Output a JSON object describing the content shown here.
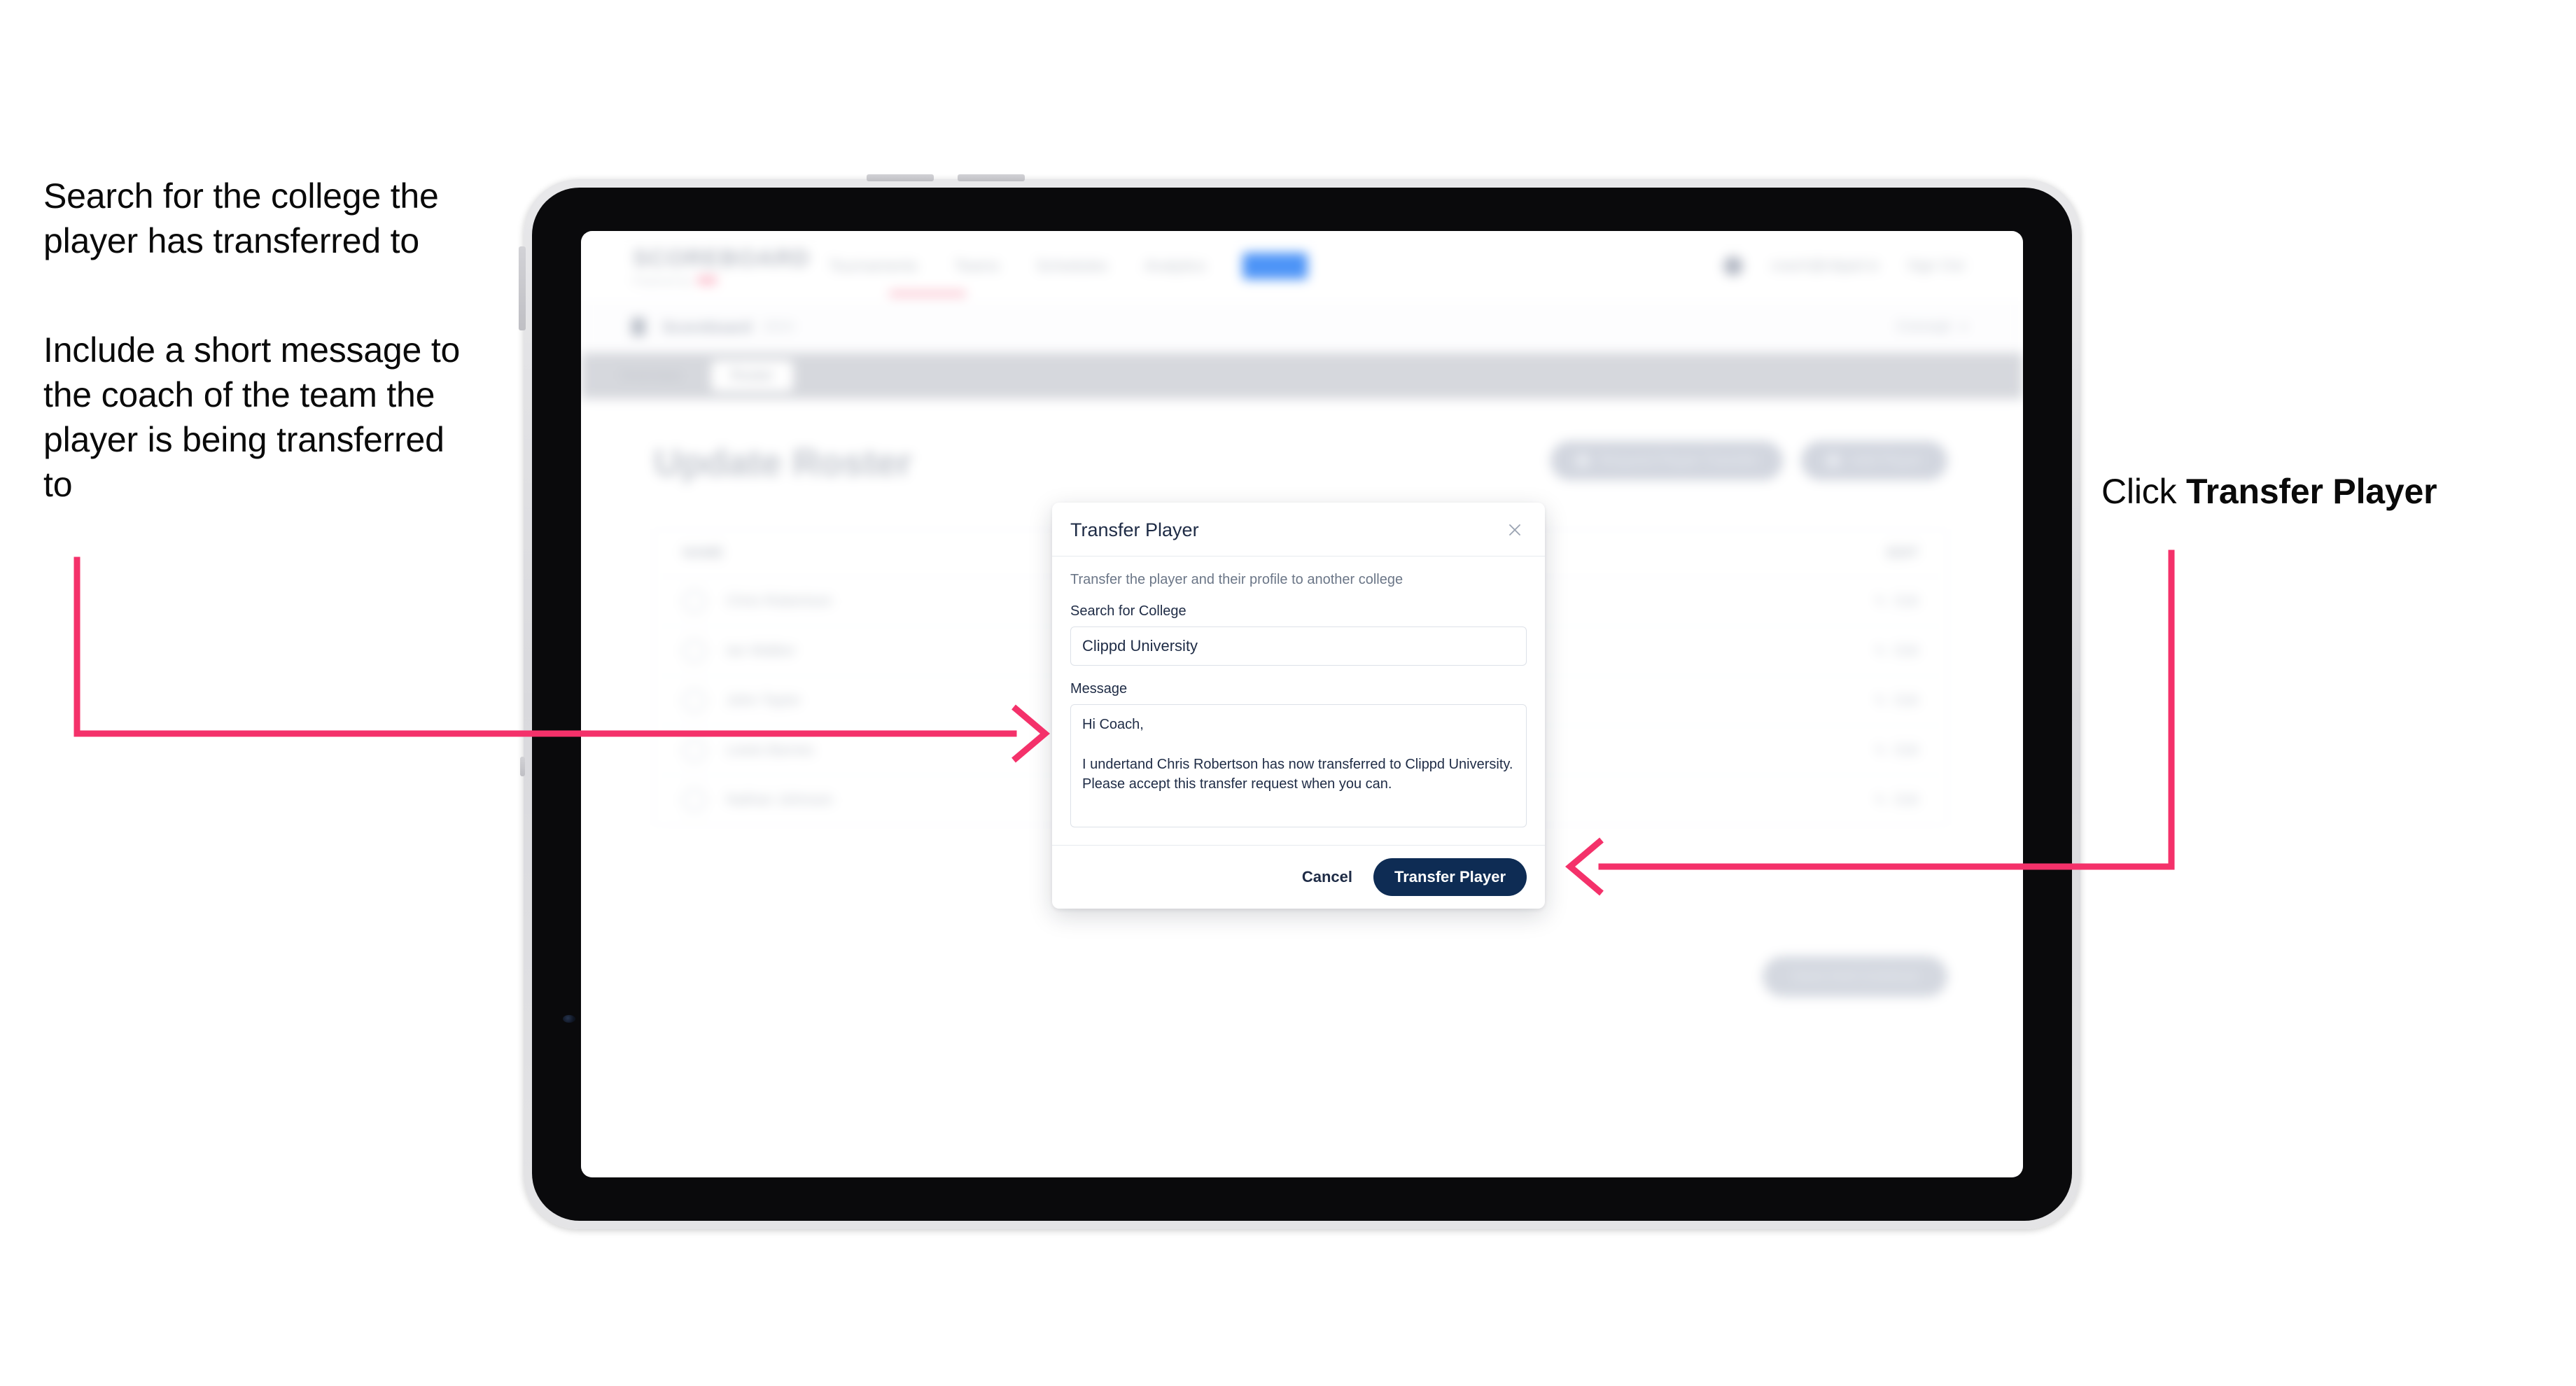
{
  "annotations": {
    "left_1": "Search for the college the player has transferred to",
    "left_2": "Include a short message to the coach of the team the player is being transferred to",
    "right_prefix": "Click ",
    "right_bold": "Transfer Player",
    "arrow_color": "#F4316A"
  },
  "app": {
    "brand": {
      "word": "SCOREBOARD",
      "sub": "Powered by",
      "dot": "clippd"
    },
    "nav": {
      "items": [
        "Tournaments",
        "Teams",
        "Schedules",
        "Analytics"
      ],
      "pill": "Roster",
      "user": "coach@clippd.io",
      "sign_out": "Sign Out"
    },
    "breadcrumb": {
      "main": "Scoreboard",
      "sub": "2024",
      "right": "Concept",
      "chevron": "chevron-down"
    },
    "tabs": [
      {
        "label": "Overview",
        "active": false
      },
      {
        "label": "Roster",
        "active": true
      }
    ],
    "page_title": "Update Roster",
    "header_actions": [
      "Request Player Transfer",
      "Add Player"
    ],
    "roster": {
      "header": {
        "name": "NAME",
        "edit": "EDIT"
      },
      "rows": [
        {
          "name": "Chris Robertson",
          "edit": "Edit"
        },
        {
          "name": "Ian Walker",
          "edit": "Edit"
        },
        {
          "name": "John Taylor",
          "edit": "Edit"
        },
        {
          "name": "Lewis Barnes",
          "edit": "Edit"
        },
        {
          "name": "Nathan Johnson",
          "edit": "Edit"
        }
      ]
    },
    "footer_button": "Save And Continue"
  },
  "modal": {
    "title": "Transfer Player",
    "close_icon": "close-icon",
    "description": "Transfer the player and their profile to another college",
    "college": {
      "label": "Search for College",
      "value": "Clippd University",
      "placeholder": "Search for College"
    },
    "message": {
      "label": "Message",
      "value": "Hi Coach,\n\nI undertand Chris Robertson has now transferred to Clippd University. Please accept this transfer request when you can.",
      "placeholder": "Message"
    },
    "cancel_label": "Cancel",
    "submit_label": "Transfer Player",
    "submit_color": "#0E2C54"
  }
}
